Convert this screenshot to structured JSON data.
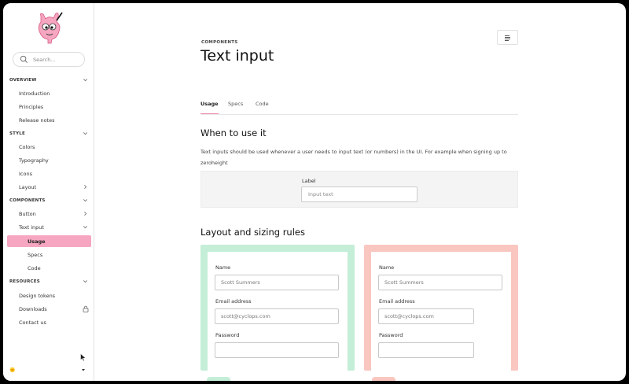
{
  "search": {
    "placeholder": "Search..."
  },
  "nav": {
    "overview": "OVERVIEW",
    "introduction": "Introduction",
    "principles": "Principles",
    "release_notes": "Release notes",
    "style": "STYLE",
    "colors": "Colors",
    "typography": "Typography",
    "icons": "Icons",
    "layout": "Layout",
    "components": "COMPONENTS",
    "button": "Button",
    "text_input": "Text input",
    "usage": "Usage",
    "specs": "Specs",
    "code": "Code",
    "resources": "RESOURCES",
    "design_tokens": "Design tokens",
    "downloads": "Downloads",
    "contact_us": "Contact us"
  },
  "footer": {
    "emoji": "🌞"
  },
  "page": {
    "kicker": "COMPONENTS",
    "title": "Text input",
    "tabs": [
      "Usage",
      "Specs",
      "Code"
    ],
    "when_heading": "When to use it",
    "when_text": "Text inputs should be used whenever a user needs to input text (or numbers) in the UI. For example when signing up to zeroheight",
    "demo": {
      "label": "Label",
      "placeholder": "Input text"
    },
    "layout_heading": "Layout and sizing rules",
    "form": {
      "name_label": "Name",
      "name_value": "Scott Summers",
      "email_label": "Email address",
      "email_value": "scott@cyclops.com",
      "password_label": "Password",
      "password_value": ""
    }
  },
  "colors": {
    "accent": "#f6a6c0",
    "good": "#c4eed7",
    "bad": "#f9c7c0"
  }
}
